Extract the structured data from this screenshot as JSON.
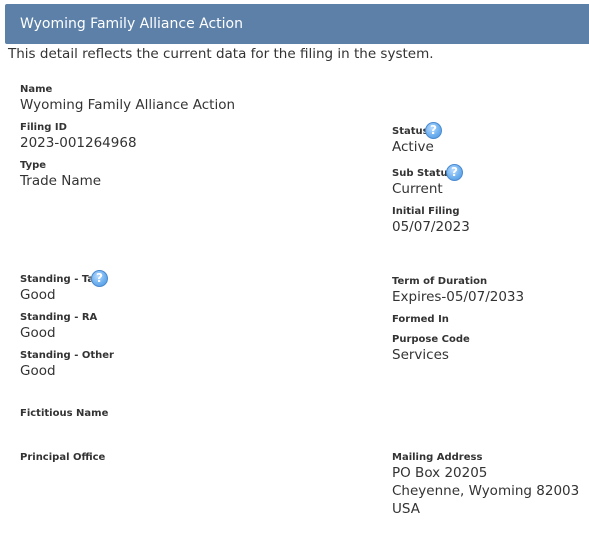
{
  "header": {
    "title": "Wyoming Family Alliance Action"
  },
  "intro": "This detail reflects the current data for the filing in the system.",
  "help_glyph": "?",
  "fields": {
    "name": {
      "label": "Name",
      "value": "Wyoming Family Alliance Action"
    },
    "filing_id": {
      "label": "Filing ID",
      "value": "2023-001264968"
    },
    "type": {
      "label": "Type",
      "value": "Trade Name"
    },
    "status": {
      "label": "Status",
      "value": "Active"
    },
    "sub_status": {
      "label": "Sub Status",
      "value": "Current"
    },
    "initial_filing": {
      "label": "Initial Filing",
      "value": "05/07/2023"
    },
    "standing_tax": {
      "label": "Standing - Tax",
      "value": "Good"
    },
    "standing_ra": {
      "label": "Standing - RA",
      "value": "Good"
    },
    "standing_other": {
      "label": "Standing - Other",
      "value": "Good"
    },
    "term_of_duration": {
      "label": "Term of Duration",
      "value": "Expires-05/07/2033"
    },
    "formed_in": {
      "label": "Formed In",
      "value": ""
    },
    "purpose_code": {
      "label": "Purpose Code",
      "value": "Services"
    },
    "fictitious_name": {
      "label": "Fictitious Name",
      "value": ""
    },
    "principal_office": {
      "label": "Principal Office",
      "value": ""
    },
    "mailing_address": {
      "label": "Mailing Address",
      "lines": [
        "PO Box 20205",
        "Cheyenne, Wyoming 82003",
        "USA"
      ]
    }
  },
  "colors": {
    "header_bg": "#5c80a8",
    "header_text": "#ffffff",
    "help_icon": "#6fb1ef"
  }
}
